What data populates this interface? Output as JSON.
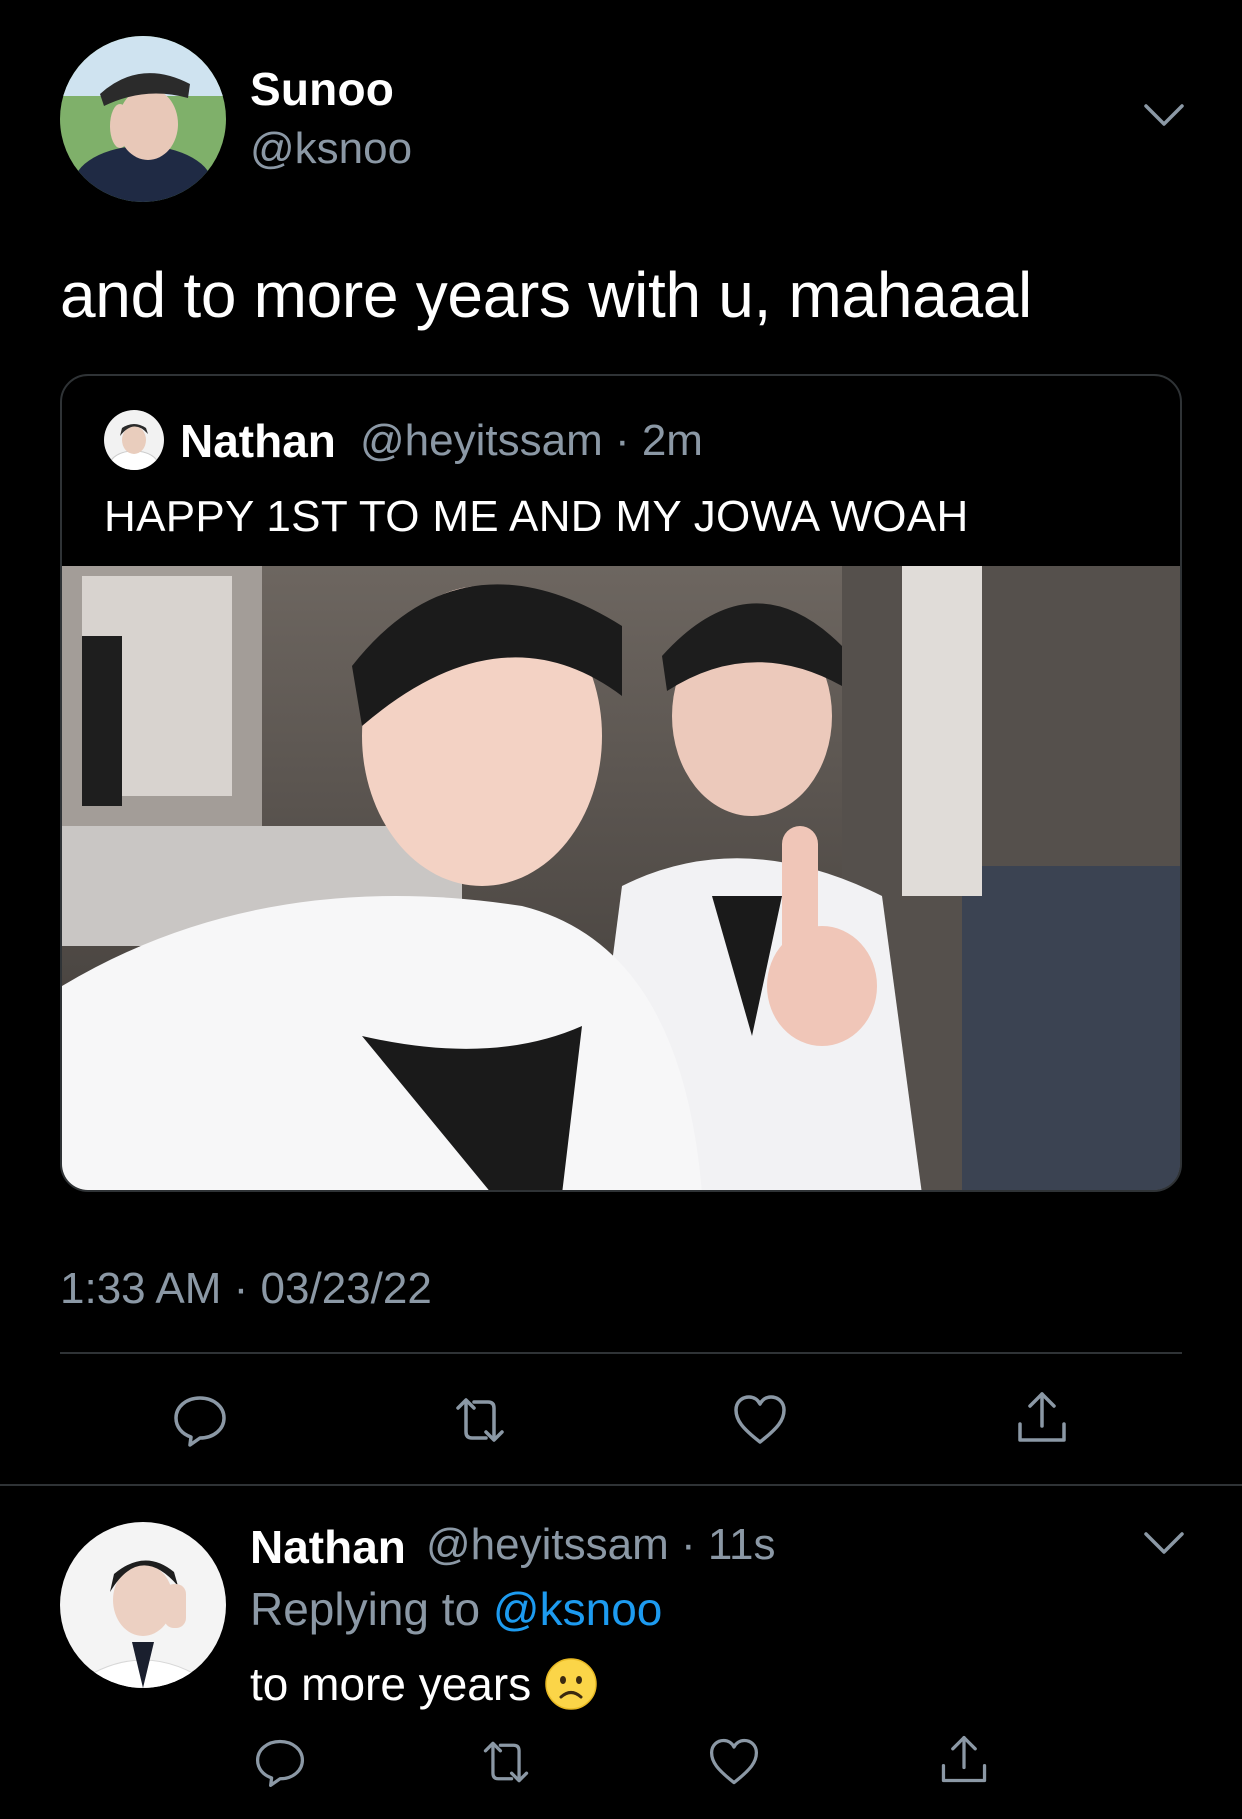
{
  "main_tweet": {
    "author_name": "Sunoo",
    "author_handle": "@ksnoo",
    "text": "and to more years with u, mahaaal",
    "timestamp": "1:33 AM · 03/23/22",
    "quoted": {
      "author_name": "Nathan",
      "meta": "@heyitssam · 2m",
      "text": "HAPPY 1ST TO ME AND MY JOWA WOAH"
    }
  },
  "reply_tweet": {
    "author_name": "Nathan",
    "meta": "@heyitssam · 11s",
    "replying_prefix": "Replying to",
    "replying_mention": "@ksnoo",
    "text": "to more years",
    "emoji": "frowning-face"
  },
  "icons": {
    "reply": "reply-icon",
    "retweet": "retweet-icon",
    "like": "heart-icon",
    "share": "share-icon",
    "more": "chevron-down-icon"
  },
  "colors": {
    "background": "#000000",
    "text_primary": "#ffffff",
    "text_secondary": "#8b98a5",
    "divider": "#2f3336",
    "link": "#1d9bf0",
    "icon": "#8b98a5"
  }
}
